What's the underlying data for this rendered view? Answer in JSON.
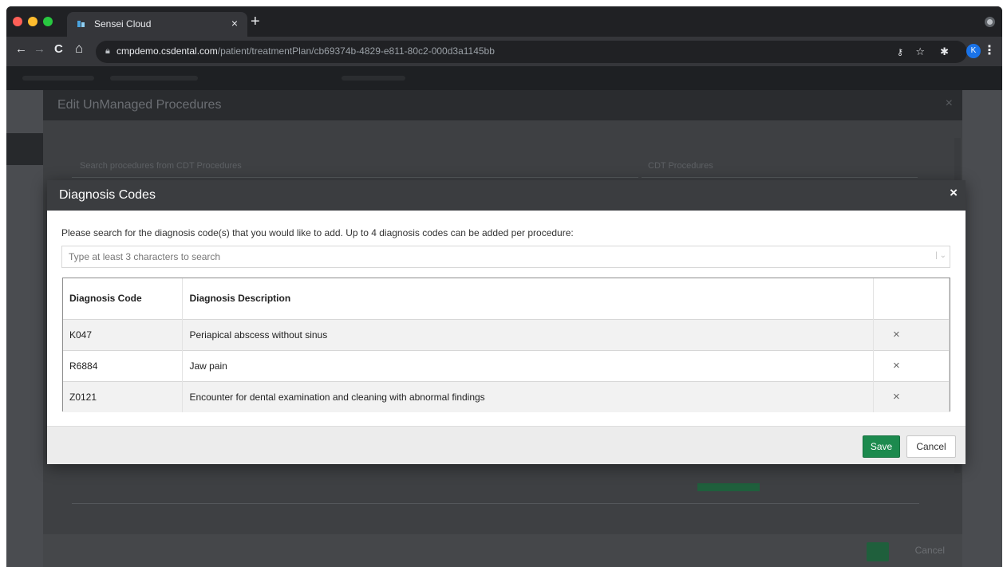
{
  "browser": {
    "tab_title": "Sensei Cloud",
    "tab_close": "×",
    "new_tab": "+",
    "url_host": "cmpdemo.csdental.com",
    "url_path": "/patient/treatmentPlan/cb69374b-4829-e811-80c2-000d3a1145bb",
    "profile_initial": "K",
    "icons": [
      "back-arrow-icon",
      "forward-arrow-icon",
      "reload-icon",
      "home-icon",
      "lock-icon",
      "key-icon",
      "star-icon",
      "puzzle-icon",
      "menu-dots-icon"
    ]
  },
  "background_modal": {
    "title": "Edit UnManaged Procedures",
    "search_placeholder": "Search procedures from CDT Procedures",
    "select_value": "CDT Procedures",
    "cancel_label": "Cancel"
  },
  "dialog": {
    "title": "Diagnosis Codes",
    "close_label": "×",
    "instruction": "Please search for the diagnosis code(s) that you would like to add. Up to 4 diagnosis codes can be added per procedure:",
    "search_placeholder": "Type at least 3 characters to search",
    "table": {
      "headers": [
        "Diagnosis Code",
        "Diagnosis Description",
        ""
      ],
      "rows": [
        {
          "code": "K047",
          "description": "Periapical abscess without sinus",
          "remove": "×"
        },
        {
          "code": "R6884",
          "description": "Jaw pain",
          "remove": "×"
        },
        {
          "code": "Z0121",
          "description": "Encounter for dental examination and cleaning with abnormal findings",
          "remove": "×"
        }
      ]
    },
    "save_label": "Save",
    "cancel_label": "Cancel"
  },
  "colors": {
    "header_bg": "#3b3d40",
    "save_green": "#1c8a4e",
    "overlay": "#4a4c50"
  }
}
